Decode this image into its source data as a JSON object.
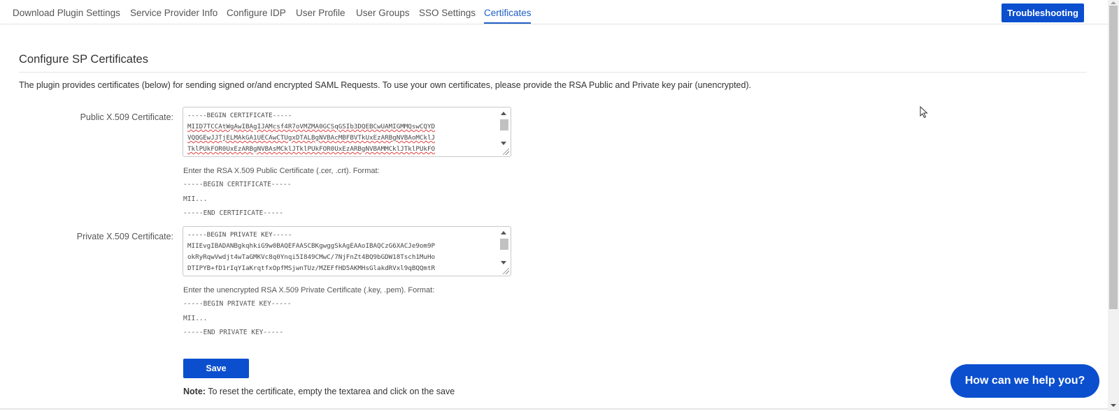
{
  "nav": {
    "tabs": [
      {
        "label": "Download Plugin Settings"
      },
      {
        "label": "Service Provider Info"
      },
      {
        "label": "Configure IDP"
      },
      {
        "label": "User Profile"
      },
      {
        "label": "User Groups"
      },
      {
        "label": "SSO Settings"
      },
      {
        "label": "Certificates"
      }
    ],
    "active_tab": "Certificates",
    "troubleshooting_label": "Troubleshooting"
  },
  "section": {
    "title": "Configure SP Certificates",
    "description": "The plugin provides certificates (below) for sending signed or/and encrypted SAML Requests. To use your own certificates, please provide the RSA Public and Private key pair (unencrypted)."
  },
  "public_cert": {
    "label": "Public X.509 Certificate:",
    "lines": [
      "-----BEGIN CERTIFICATE-----",
      "MIID7TCCAtWgAwIBAgIJAMcsf4R7oVMZMA0GCSqGSIb3DQEBCwUAMIGMMQswCQYD",
      "VQQGEwJJTjELMAkGA1UECAwCTUgxDTALBgNVBAcMBFBVTkUxEzARBgNVBAoMCklJ",
      "TklPUkFOR0UxEzARBgNVBAsMCklJTklPUkFOR0UxEzARBgNVBAMMCklJTklPUkFO"
    ],
    "hint": "Enter the RSA X.509 Public Certificate (.cer, .crt). Format:",
    "format": [
      "-----BEGIN CERTIFICATE-----",
      "MII...",
      "-----END CERTIFICATE-----"
    ]
  },
  "private_cert": {
    "label": "Private X.509 Certificate:",
    "lines": [
      "-----BEGIN PRIVATE KEY-----",
      "MIIEvgIBADANBgkqhkiG9w0BAQEFAASCBKgwggSkAgEAAoIBAQCzG6XACJe9om9P",
      "okRyRqwVwdjt4wTaGMKVc8q0Ynqi5I849CMwC/7NjFnZt4BQ9bGDW18Tsch1MuHo",
      "DTIPYB+fD1rIqYIaKrqtfxOpfMSjwnTUz/MZEFfHD5AKMHsGlakdRVxl9qBQQmtR"
    ],
    "hint": "Enter the unencrypted RSA X.509 Private Certificate (.key, .pem). Format:",
    "format": [
      "-----BEGIN PRIVATE KEY-----",
      "MII...",
      "-----END PRIVATE KEY-----"
    ]
  },
  "save_label": "Save",
  "note": {
    "bold": "Note:",
    "text": " To reset the certificate, empty the textarea and click on the save"
  },
  "help_label": "How can we help you?",
  "colors": {
    "accent": "#0b4fcf",
    "active_tab": "#1f5fc4"
  }
}
